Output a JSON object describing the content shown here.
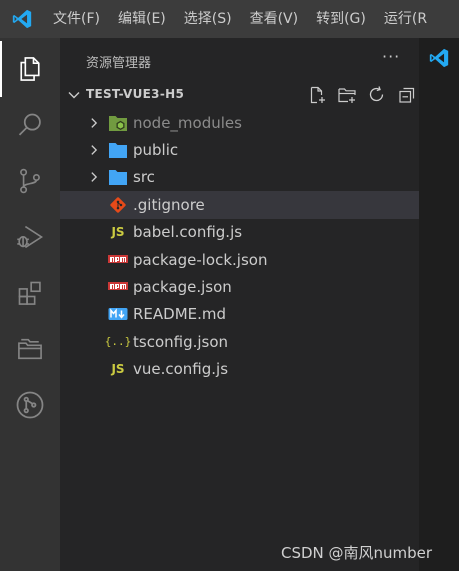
{
  "menu": {
    "items": [
      "文件(F)",
      "编辑(E)",
      "选择(S)",
      "查看(V)",
      "转到(G)",
      "运行(R"
    ]
  },
  "activity_bar": {
    "items": [
      "explorer-icon",
      "search-icon",
      "source-control-icon",
      "run-debug-icon",
      "extensions-icon",
      "remote-explorer-icon",
      "git-graph-icon"
    ],
    "active": "explorer-icon"
  },
  "sidebar": {
    "title": "资源管理器",
    "more": "···",
    "section": {
      "name": "TEST-VUE3-H5",
      "actions": [
        "new-file-icon",
        "new-folder-icon",
        "refresh-icon",
        "collapse-all-icon"
      ]
    },
    "tree": [
      {
        "label": "node_modules",
        "kind": "folder",
        "icon": "node-folder-icon",
        "dim": true
      },
      {
        "label": "public",
        "kind": "folder",
        "icon": "folder-icon"
      },
      {
        "label": "src",
        "kind": "folder",
        "icon": "folder-icon"
      },
      {
        "label": ".gitignore",
        "kind": "file",
        "icon": "git-icon",
        "selected": true
      },
      {
        "label": "babel.config.js",
        "kind": "file",
        "icon": "js-icon"
      },
      {
        "label": "package-lock.json",
        "kind": "file",
        "icon": "npm-icon"
      },
      {
        "label": "package.json",
        "kind": "file",
        "icon": "npm-icon"
      },
      {
        "label": "README.md",
        "kind": "file",
        "icon": "markdown-icon"
      },
      {
        "label": "tsconfig.json",
        "kind": "file",
        "icon": "json-icon"
      },
      {
        "label": "vue.config.js",
        "kind": "file",
        "icon": "js-icon"
      }
    ]
  },
  "watermark": "CSDN @南风number",
  "colors": {
    "titlebar": "#3c3c3c",
    "activitybar": "#333333",
    "sidebar": "#252526",
    "selected_row": "#37373d",
    "editor": "#1e1e1e",
    "vscode_blue": "#23a9f2",
    "folder_blue": "#42a5f5"
  }
}
